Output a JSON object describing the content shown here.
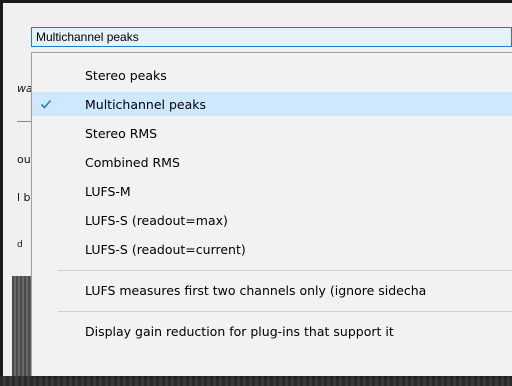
{
  "combo": {
    "selected": "Multichannel peaks"
  },
  "background_fragments": {
    "f1": "wa",
    "f2": "ou",
    "f3": "l b",
    "f4": "d"
  },
  "menu": {
    "items": [
      {
        "label": "Stereo peaks",
        "checked": false
      },
      {
        "label": "Multichannel peaks",
        "checked": true
      },
      {
        "label": "Stereo RMS",
        "checked": false
      },
      {
        "label": "Combined RMS",
        "checked": false
      },
      {
        "label": "LUFS-M",
        "checked": false
      },
      {
        "label": "LUFS-S (readout=max)",
        "checked": false
      },
      {
        "label": "LUFS-S (readout=current)",
        "checked": false
      },
      {
        "label": "LUFS measures first two channels only (ignore sidecha",
        "checked": false
      },
      {
        "label": "Display gain reduction for plug-ins that support it",
        "checked": false
      }
    ]
  },
  "colors": {
    "selection_highlight": "#cde8ff",
    "check_mark": "#2677d6",
    "combo_border": "#2677d6"
  }
}
